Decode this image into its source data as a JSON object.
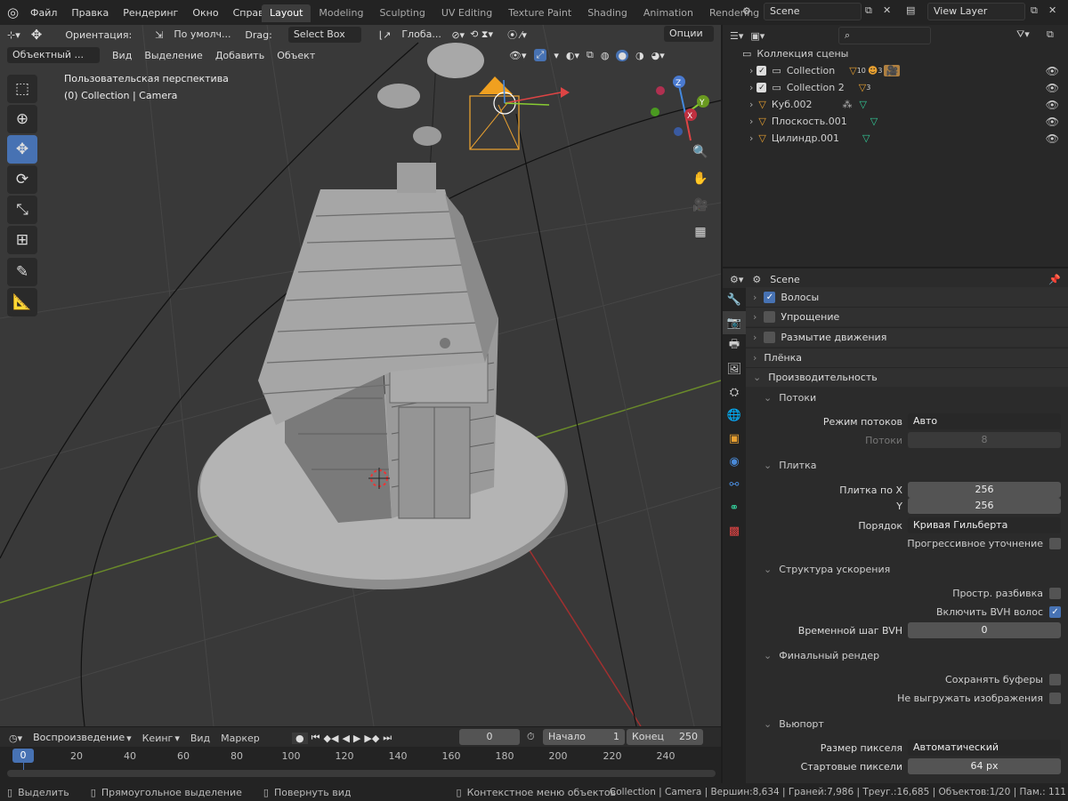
{
  "menu": [
    "Файл",
    "Правка",
    "Рендеринг",
    "Окно",
    "Справка"
  ],
  "workspaces": [
    "Layout",
    "Modeling",
    "Sculpting",
    "UV Editing",
    "Texture Paint",
    "Shading",
    "Animation",
    "Rendering",
    "Co"
  ],
  "scene": "Scene",
  "view_layer": "View Layer",
  "viewport": {
    "orientation_label": "Ориентация:",
    "orientation_value": "По умолч...",
    "drag_label": "Drag:",
    "drag_value": "Select Box",
    "transform": "Глоба...",
    "options": "Опции",
    "mode": "Объектный ...",
    "menu": [
      "Вид",
      "Выделение",
      "Добавить",
      "Объект"
    ],
    "perspective": "Пользовательская перспектива",
    "context": "(0) Collection | Camera",
    "gizmo": {
      "z": "Z",
      "y": "Y",
      "x": "X"
    }
  },
  "outliner": {
    "root": "Коллекция сцены",
    "items": [
      {
        "name": "Collection",
        "badge": "10",
        "badge2": "3"
      },
      {
        "name": "Collection 2",
        "badge": "3"
      },
      {
        "name": "Куб.002"
      },
      {
        "name": "Плоскость.001"
      },
      {
        "name": "Цилиндр.001"
      }
    ]
  },
  "properties": {
    "context": "Scene",
    "hair": "Волосы",
    "simplify": "Упрощение",
    "motion_blur": "Размытие движения",
    "film": "Плёнка",
    "performance": "Производительность",
    "threads": "Потоки",
    "threads_mode_label": "Режим потоков",
    "threads_mode": "Авто",
    "threads_count_label": "Потоки",
    "threads_count": "8",
    "tiles": "Плитка",
    "tile_x_label": "Плитка по X",
    "tile_x": "256",
    "tile_y_label": "Y",
    "tile_y": "256",
    "order_label": "Порядок",
    "order": "Кривая Гильберта",
    "progressive": "Прогрессивное уточнение",
    "accel": "Структура ускорения",
    "spatial_split": "Простр. разбивка",
    "hair_bvh": "Включить BVH волос",
    "bvh_step_label": "Временной шаг BVH",
    "bvh_step": "0",
    "final_render": "Финальный рендер",
    "save_buffers": "Сохранять буферы",
    "persistent_images": "Не выгружать изображения",
    "viewport_sec": "Вьюпорт",
    "pixel_size_label": "Размер пикселя",
    "pixel_size": "Автоматический",
    "start_pixels_label": "Стартовые пиксели",
    "start_pixels": "64 px"
  },
  "timeline": {
    "playback": "Воспроизведение",
    "keying": "Кеинг",
    "view": "Вид",
    "marker": "Маркер",
    "current": "0",
    "start_label": "Начало",
    "start": "1",
    "end_label": "Конец",
    "end": "250",
    "ticks": [
      "0",
      "20",
      "40",
      "60",
      "80",
      "100",
      "120",
      "140",
      "160",
      "180",
      "200",
      "220",
      "240"
    ]
  },
  "statusbar": {
    "select": "Выделить",
    "box_select": "Прямоугольное выделение",
    "rotate_view": "Повернуть вид",
    "context_menu": "Контекстное меню объектов",
    "stats": "Collection | Camera | Вершин:8,634 | Граней:7,986 | Треуг.:16,685 | Объектов:1/20 | Пам.: 111"
  }
}
